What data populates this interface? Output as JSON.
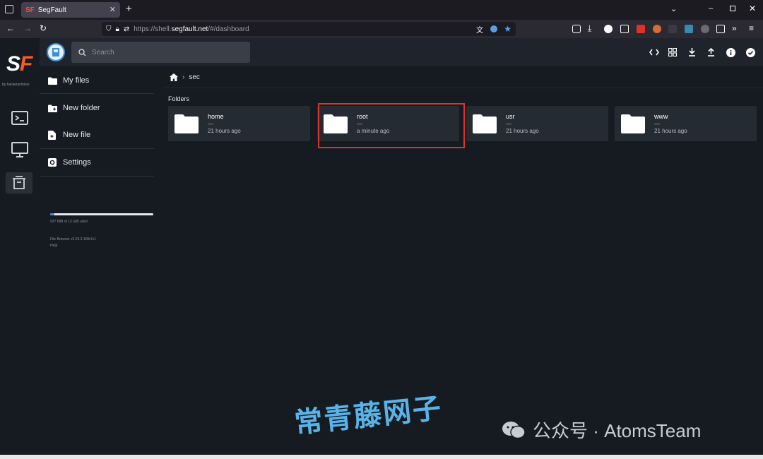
{
  "browser": {
    "tab_title": "SegFault",
    "tab_favicon": "SF",
    "url_prefix": "https://shell.",
    "url_host": "segfault.net",
    "url_path": "/#/dashboard"
  },
  "app": {
    "logo": "SF",
    "logo_sub": "by hackerschoice",
    "search_placeholder": "Search",
    "sidebar": {
      "my_files": "My files",
      "new_folder": "New folder",
      "new_file": "New file",
      "settings": "Settings"
    },
    "usage_text": "937 MiB of 12 GiB used",
    "usage_fraction": 0.04,
    "version_text": "File Browser v2.24.2-1f6b7c1",
    "help_text": "Help",
    "breadcrumb": {
      "current": "sec"
    },
    "folders_title": "Folders",
    "folders": [
      {
        "name": "home",
        "size": "—",
        "modified": "21 hours ago"
      },
      {
        "name": "root",
        "size": "—",
        "modified": "a minute ago"
      },
      {
        "name": "usr",
        "size": "—",
        "modified": "21 hours ago"
      },
      {
        "name": "www",
        "size": "—",
        "modified": "21 hours ago"
      }
    ]
  },
  "watermark": {
    "chinese": "常青藤网子",
    "english": "公众号 · AtomsTeam"
  },
  "colors": {
    "accent": "#3d8ed8",
    "highlight": "#e0302a",
    "logo_orange": "#ff5a1f"
  }
}
